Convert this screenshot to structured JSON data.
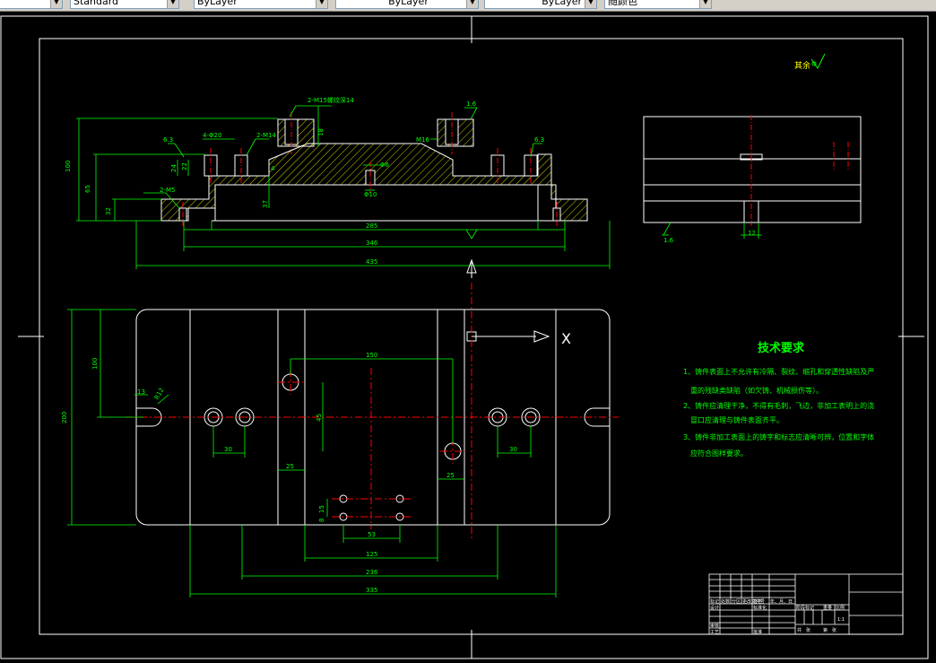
{
  "toolbar": {
    "text_style": "Standard",
    "layer": "ByLayer",
    "linetype": "ByLayer",
    "lineweight": "ByLayer",
    "plot_style": "随颜色"
  },
  "drawing": {
    "roughness_other": "其余",
    "front_view_dims": {
      "h100": "100",
      "h65": "65",
      "h32": "32",
      "holes_top": "2-M15螺纹深14",
      "holes_depth": "18",
      "holes_left": "4-Φ20",
      "holes_mid": "2-M14",
      "thread_m16": "M16",
      "hole_phi10": "Φ10",
      "phi6": "Φ6",
      "holes_m5": "2-M5",
      "r63_left": "6.3",
      "r63_right": "6.3",
      "r16": "1.6",
      "d24": "24",
      "d22": "22",
      "d37": "37",
      "d4": "4",
      "w285": "285",
      "w346": "346",
      "w435": "435"
    },
    "side_view_dims": {
      "r16": "1.6",
      "w12": "12"
    },
    "plan_view_dims": {
      "h100": "100",
      "h200": "200",
      "d13": "13",
      "r12": "R12",
      "d150": "150",
      "d45": "45",
      "d30_left": "30",
      "d30_right": "30",
      "d25_left": "25",
      "d25_right": "25",
      "d15": "15",
      "d8": "8",
      "d53": "53",
      "d125": "125",
      "d236": "236",
      "d335": "335",
      "x_label": "X"
    },
    "tech_req": {
      "title": "技术要求",
      "items": [
        "1、铸件表面上不允许有冷隔、裂纹、缩孔和穿透性缺陷及严",
        "重的残缺类缺陷（如欠铸、机械损伤等）。",
        "2、铸件应清理干净，不得有毛刺，飞边，非加工表明上的浇",
        "冒口应清理与铸件表面齐平。",
        "3、铸件非加工表面上的铸字和标志应清晰可辨，位置和字体",
        "应符合图样要求。"
      ]
    },
    "title_block": {
      "row_labels": [
        "标记",
        "处数",
        "分区",
        "更改文件号",
        "签名",
        "年、月、日"
      ],
      "design": "设计",
      "standardize": "标准化",
      "review": "审核",
      "process": "工艺",
      "approve": "批准",
      "stage": "阶段标记",
      "weight": "重量",
      "scale": "比例",
      "scale_value": "1:1",
      "sheets_total": "共　张",
      "sheet_no": "第　张"
    }
  },
  "colors": {
    "background": "#000000",
    "border": "#ffffff",
    "outline": "#ffffff",
    "dimension": "#00ff00",
    "center_line": "#ff0000",
    "hatch": "#ffff00",
    "title_text": "#00ff00"
  }
}
